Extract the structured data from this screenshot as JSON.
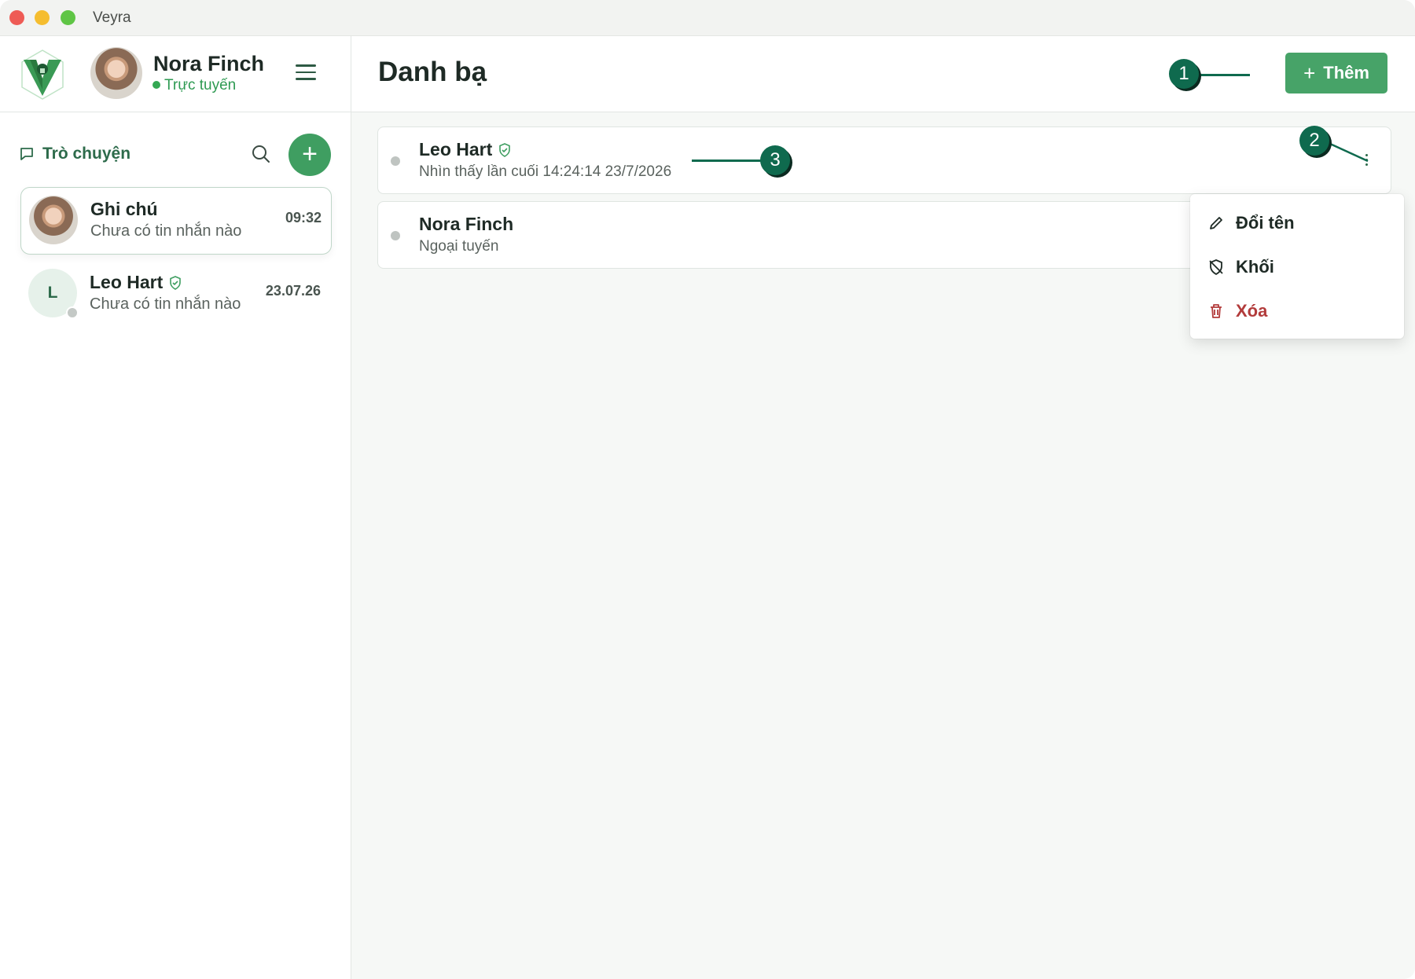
{
  "window": {
    "title": "Veyra"
  },
  "sidebar": {
    "user": {
      "name": "Nora Finch",
      "status": "Trực tuyến"
    },
    "section_label": "Trò chuyện",
    "chats": [
      {
        "name": "Ghi chú",
        "preview": "Chưa có tin nhắn nào",
        "time": "09:32",
        "avatar": "photo"
      },
      {
        "name": "Leo Hart",
        "preview": "Chưa có tin nhắn nào",
        "time": "23.07.26",
        "avatar_letter": "L",
        "verified": true
      }
    ]
  },
  "main": {
    "title": "Danh bạ",
    "add_button": "Thêm",
    "contacts": [
      {
        "name": "Leo Hart",
        "subtitle": "Nhìn thấy lần cuối 14:24:14 23/7/2026",
        "verified": true
      },
      {
        "name": "Nora Finch",
        "subtitle": "Ngoại tuyến"
      }
    ]
  },
  "context_menu": {
    "items": [
      {
        "label": "Đổi tên",
        "icon": "pencil-icon"
      },
      {
        "label": "Khối",
        "icon": "shield-off-icon"
      },
      {
        "label": "Xóa",
        "icon": "trash-icon",
        "color": "#b23b3b"
      }
    ]
  },
  "callouts": [
    "1",
    "2",
    "3"
  ],
  "colors": {
    "accent": "#47a368",
    "brand_dark": "#0f6a4e",
    "danger": "#b23b3b"
  }
}
